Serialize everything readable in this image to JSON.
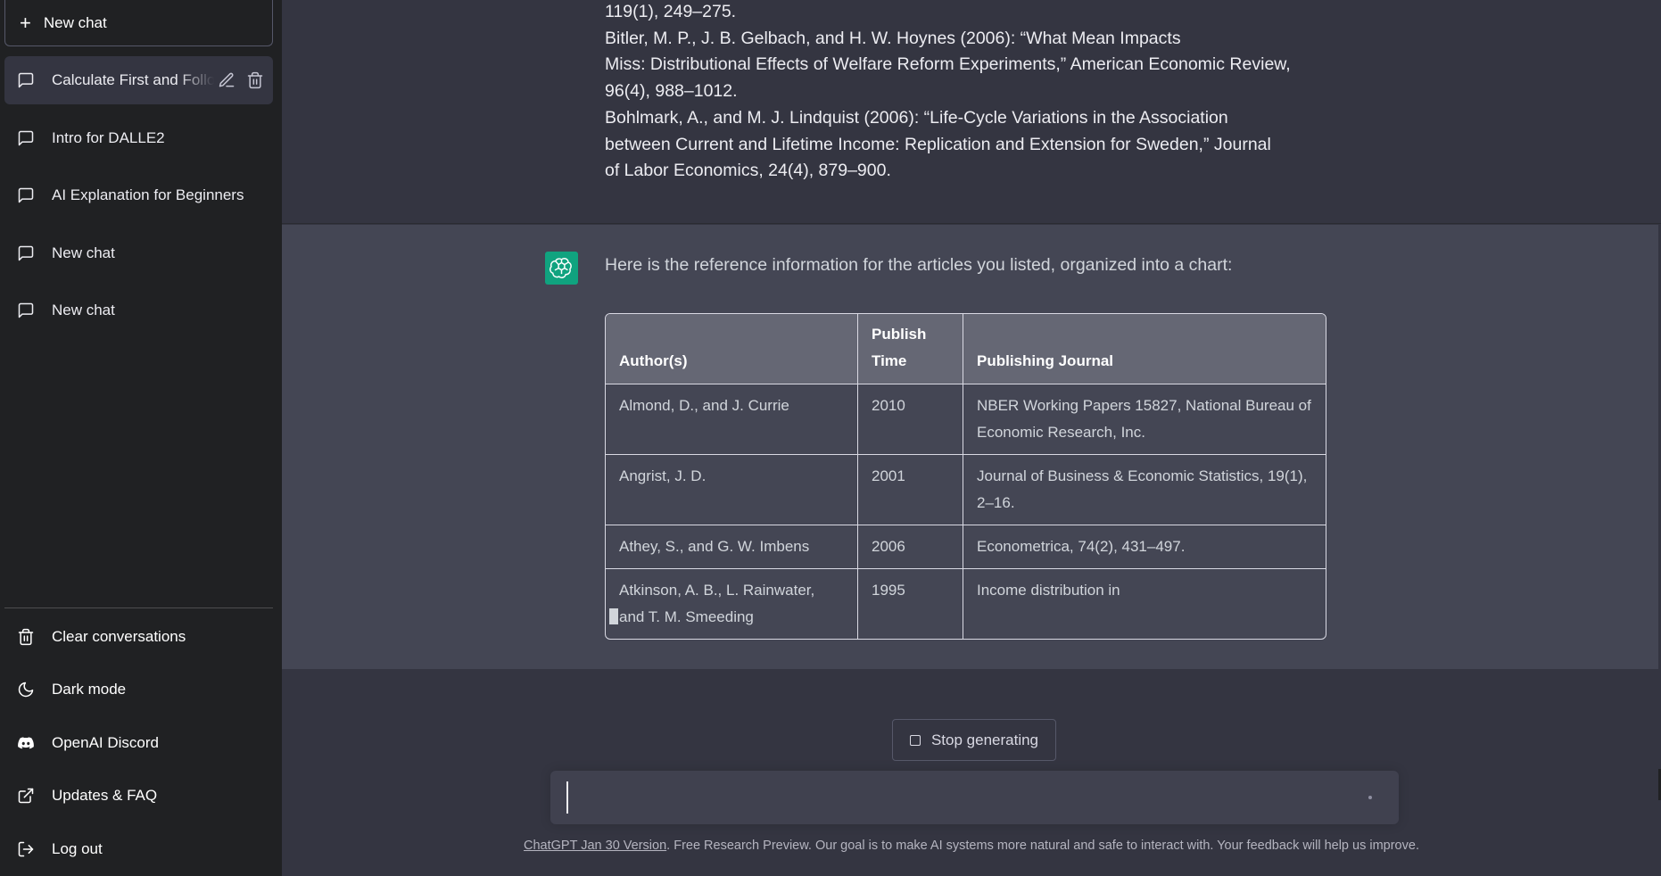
{
  "sidebar": {
    "new_chat_label": "New chat",
    "chats": [
      {
        "label": "Calculate First and Following",
        "active": true
      },
      {
        "label": "Intro for DALLE2"
      },
      {
        "label": "AI Explanation for Beginners"
      },
      {
        "label": "New chat"
      },
      {
        "label": "New chat"
      }
    ],
    "menu": {
      "clear": "Clear conversations",
      "dark_mode": "Dark mode",
      "discord": "OpenAI Discord",
      "faq": "Updates & FAQ",
      "logout": "Log out"
    }
  },
  "user_message": {
    "lines": [
      "119(1), 249–275.",
      "Bitler, M. P., J. B. Gelbach, and H. W. Hoynes (2006): “What Mean Impacts",
      "Miss: Distributional Effects of Welfare Reform Experiments,” American Economic Review,",
      "96(4), 988–1012.",
      "Bohlmark, A., and M. J. Lindquist (2006): “Life-Cycle Variations in the Association",
      "between Current and Lifetime Income: Replication and Extension for Sweden,” Journal",
      "of Labor Economics, 24(4), 879–900."
    ]
  },
  "assistant": {
    "intro": "Here is the reference information for the articles you listed, organized into a chart:",
    "table": {
      "headers": [
        "Author(s)",
        "Publish Time",
        "Publishing Journal"
      ],
      "rows": [
        [
          "Almond, D., and J. Currie",
          "2010",
          "NBER Working Papers 15827, National Bureau of Economic Research, Inc."
        ],
        [
          "Angrist, J. D.",
          "2001",
          "Journal of Business & Economic Statistics, 19(1), 2–16."
        ],
        [
          "Athey, S., and G. W. Imbens",
          "2006",
          "Econometrica, 74(2), 431–497."
        ],
        [
          "Atkinson, A. B., L. Rainwater, and T. M. Smeeding",
          "1995",
          "Income distribution in"
        ]
      ]
    }
  },
  "stop_button": "Stop generating",
  "input": {
    "value": "",
    "placeholder": ""
  },
  "footer": {
    "link": "ChatGPT Jan 30 Version",
    "text": ". Free Research Preview. Our goal is to make AI systems more natural and safe to interact with. Your feedback will help us improve."
  },
  "colors": {
    "brand": "#10a37f",
    "sidebar": "#202123",
    "main": "#343541",
    "assistant_bg": "#444654"
  }
}
